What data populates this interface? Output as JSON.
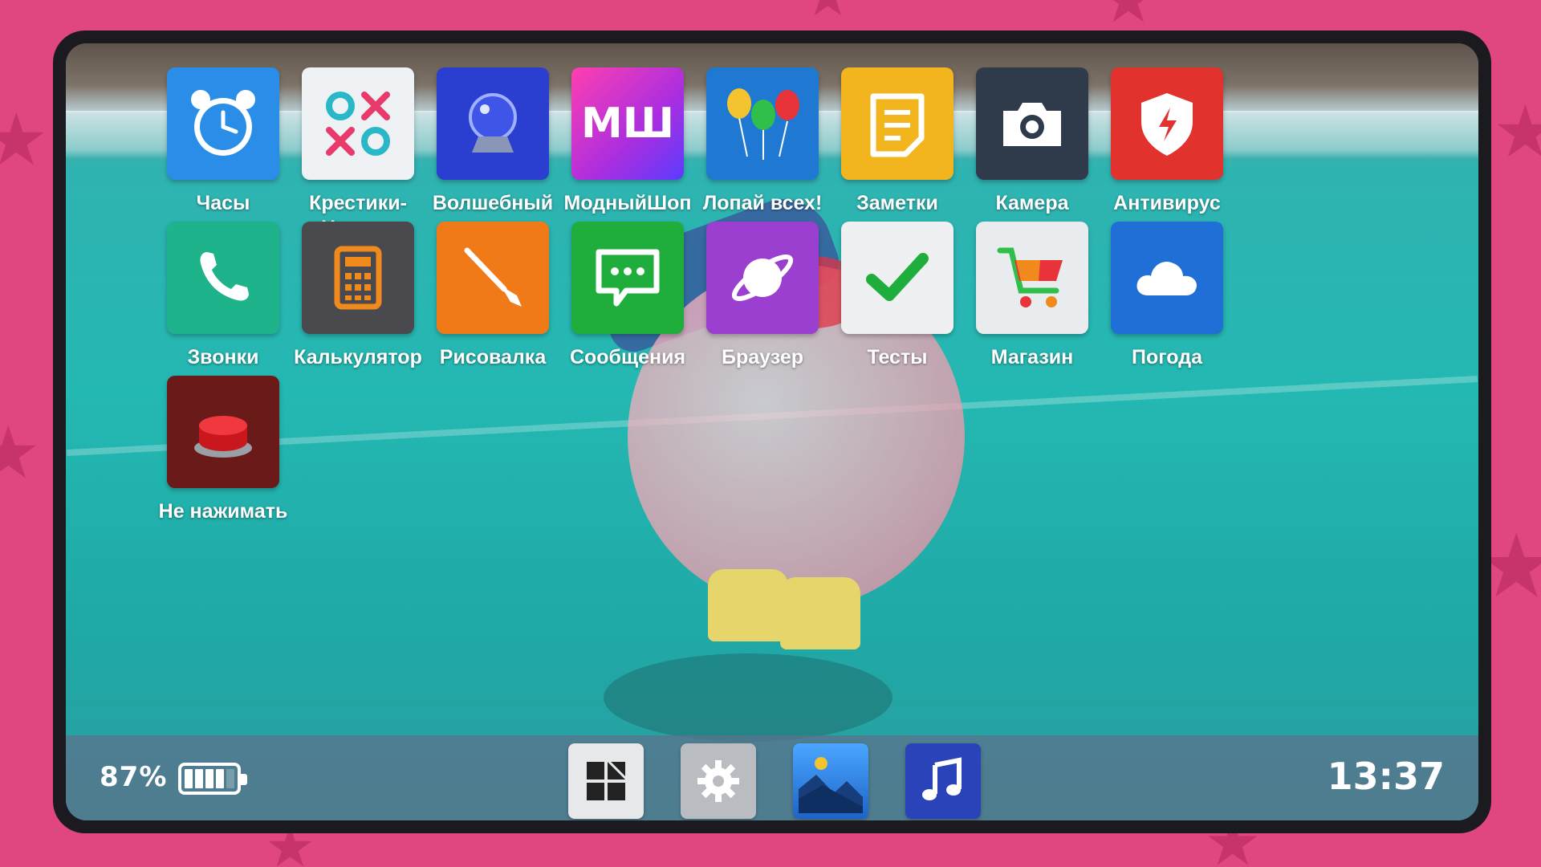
{
  "apps": [
    {
      "label": "Часы",
      "icon": "alarm-clock-icon",
      "color": "#2a8ee8"
    },
    {
      "label": "Крестики-\nНолики",
      "icon": "tic-tac-toe-icon",
      "color": "#eef2f4"
    },
    {
      "label": "Волшебный\nшар",
      "icon": "crystal-ball-icon",
      "color": "#2a3fd0"
    },
    {
      "label": "МодныйШоп",
      "icon": "fashion-shop-icon",
      "color": "#c12fd1",
      "icon_text": "МШ"
    },
    {
      "label": "Лопай всех!",
      "icon": "balloons-icon",
      "color": "#1f78d2"
    },
    {
      "label": "Заметки",
      "icon": "notes-icon",
      "color": "#f2b51d"
    },
    {
      "label": "Камера",
      "icon": "camera-icon",
      "color": "#2f3a4a"
    },
    {
      "label": "Антивирус",
      "icon": "shield-icon",
      "color": "#e2322d"
    },
    {
      "label": "Звонки",
      "icon": "phone-icon",
      "color": "#1fb38c"
    },
    {
      "label": "Калькулятор",
      "icon": "calculator-icon",
      "color": "#4a4a4e"
    },
    {
      "label": "Рисовалка",
      "icon": "paintbrush-icon",
      "color": "#f07a18"
    },
    {
      "label": "Сообщения",
      "icon": "chat-bubble-icon",
      "color": "#1fae3c"
    },
    {
      "label": "Браузер",
      "icon": "planet-icon",
      "color": "#9a3fcf"
    },
    {
      "label": "Тесты",
      "icon": "checkmark-icon",
      "color": "#eef0f1"
    },
    {
      "label": "Магазин",
      "icon": "shopping-cart-icon",
      "color": "#e8ecee"
    },
    {
      "label": "Погода",
      "icon": "cloud-icon",
      "color": "#1f6fd6"
    },
    {
      "label": "Не нажимать",
      "icon": "red-button-icon",
      "color": "#6b1a1a"
    }
  ],
  "status": {
    "battery_percent": "87%",
    "battery_level": 0.87,
    "time": "13:37"
  },
  "dock": [
    {
      "icon": "windows-grid-icon",
      "color": "#e6e8ea"
    },
    {
      "icon": "gear-icon",
      "color": "#b9bcc0"
    },
    {
      "icon": "gallery-icon",
      "color": "#2a6fd6"
    },
    {
      "icon": "music-note-icon",
      "color": "#2a43b8"
    }
  ]
}
